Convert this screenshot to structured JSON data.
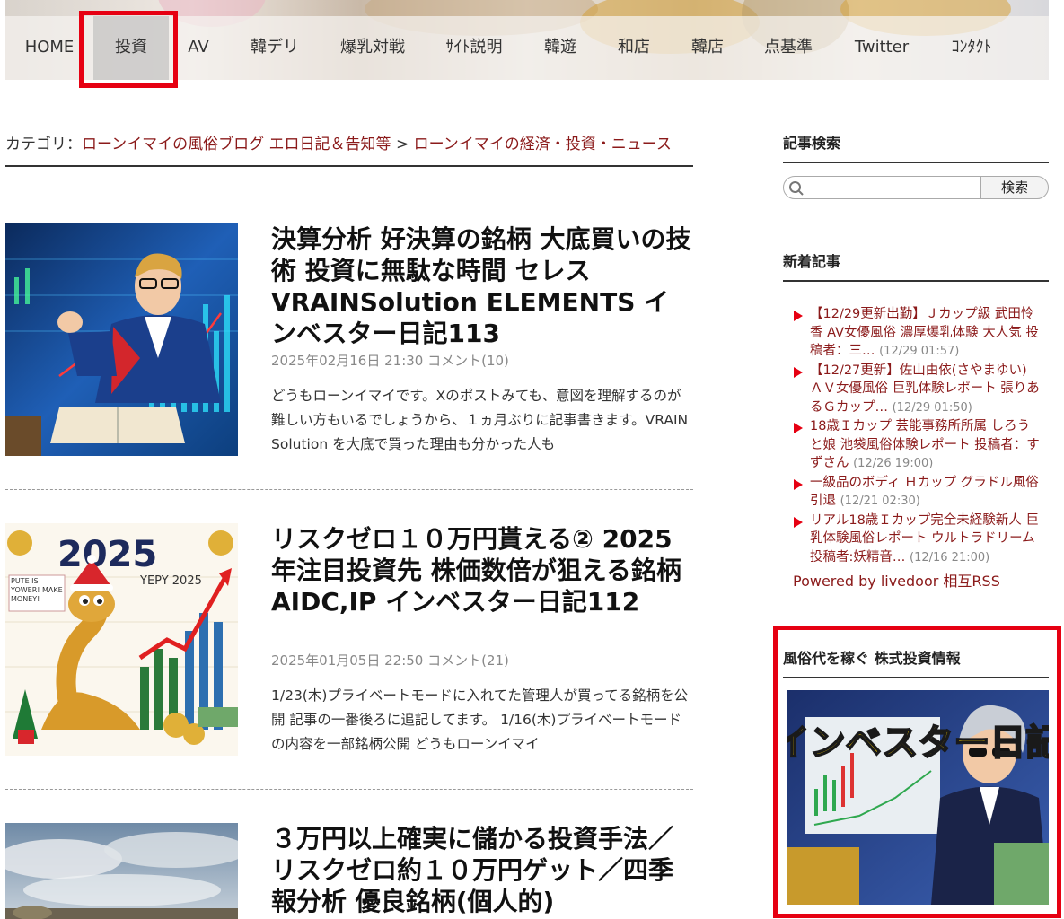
{
  "nav": {
    "items": [
      "HOME",
      "投資",
      "AV",
      "韓デリ",
      "爆乳対戦",
      "ｻｲﾄ説明",
      "韓遊",
      "和店",
      "韓店",
      "点基準",
      "Twitter",
      "ｺﾝﾀｸﾄ"
    ],
    "active_index": 1
  },
  "breadcrumb": {
    "prefix": "カテゴリ：",
    "parent": "ローンイマイの風俗ブログ エロ日記＆告知等",
    "separator": " > ",
    "current": "ローンイマイの経済・投資・ニュース"
  },
  "articles": [
    {
      "title": "決算分析 好決算の銘柄 大底買いの技術 投資に無駄な時間 セレス VRAINSolution ELEMENTS インベスター日記113",
      "meta": "2025年02月16日 21:30 コメント(10)",
      "excerpt": "どうもローンイマイです。Xのポストみても、意図を理解するのが難しい方もいるでしょうから、１ヵ月ぶりに記事書きます。VRAIN Solution を大底で買った理由も分かった人も"
    },
    {
      "title": "リスクゼロ１０万円貰える② 2025年注目投資先 株価数倍が狙える銘柄 AIDC,IP インベスター日記112",
      "meta": "2025年01月05日 22:50 コメント(21)",
      "excerpt": "1/23(木)プライベートモードに入れてた管理人が買ってる銘柄を公開 記事の一番後ろに追記してます。 1/16(木)プライベートモードの内容を一部銘柄公開 どうもローンイマイ"
    },
    {
      "title": "３万円以上確実に儲かる投資手法／リスクゼロ約１０万円ゲット／四季報分析 優良銘柄(個人的)",
      "meta": "",
      "excerpt": ""
    }
  ],
  "thumb2_text": {
    "year": "2025",
    "sign": "PUTE IS YOWER! MAKE MONEY!",
    "tag": "YEPY 2025"
  },
  "sidebar": {
    "search_title": "記事検索",
    "search_placeholder": "",
    "search_button": "検索",
    "news_title": "新着記事",
    "news": [
      {
        "text": "【12/29更新出勤】Ｊカップ級 武田怜香 AV女優風俗 濃厚爆乳体験 大人気 投稿者：三…",
        "date": "(12/29 01:57)"
      },
      {
        "text": "【12/27更新】佐山由依(さやまゆい) ＡＶ女優風俗 巨乳体験レポート 張りあるＧカップ…",
        "date": "(12/29 01:50)"
      },
      {
        "text": "18歳Ｉカップ 芸能事務所所属 しろうと娘 池袋風俗体験レポート 投稿者：すずさん",
        "date": "(12/26 19:00)"
      },
      {
        "text": "一級品のボディ Ｈカップ グラドル風俗引退",
        "date": "(12/21 02:30)"
      },
      {
        "text": "リアル18歳Ｉカップ完全未経験新人 巨乳体験風俗レポート ウルトラドリーム 投稿者:妖精音…",
        "date": "(12/16 21:00)"
      }
    ],
    "powered": "Powered by livedoor 相互RSS",
    "ad_title": "風俗代を稼ぐ 株式投資情報",
    "ad_banner_text": "インベスター日記"
  },
  "colors": {
    "accent_red": "#e60012",
    "link": "#8b1a1a"
  }
}
